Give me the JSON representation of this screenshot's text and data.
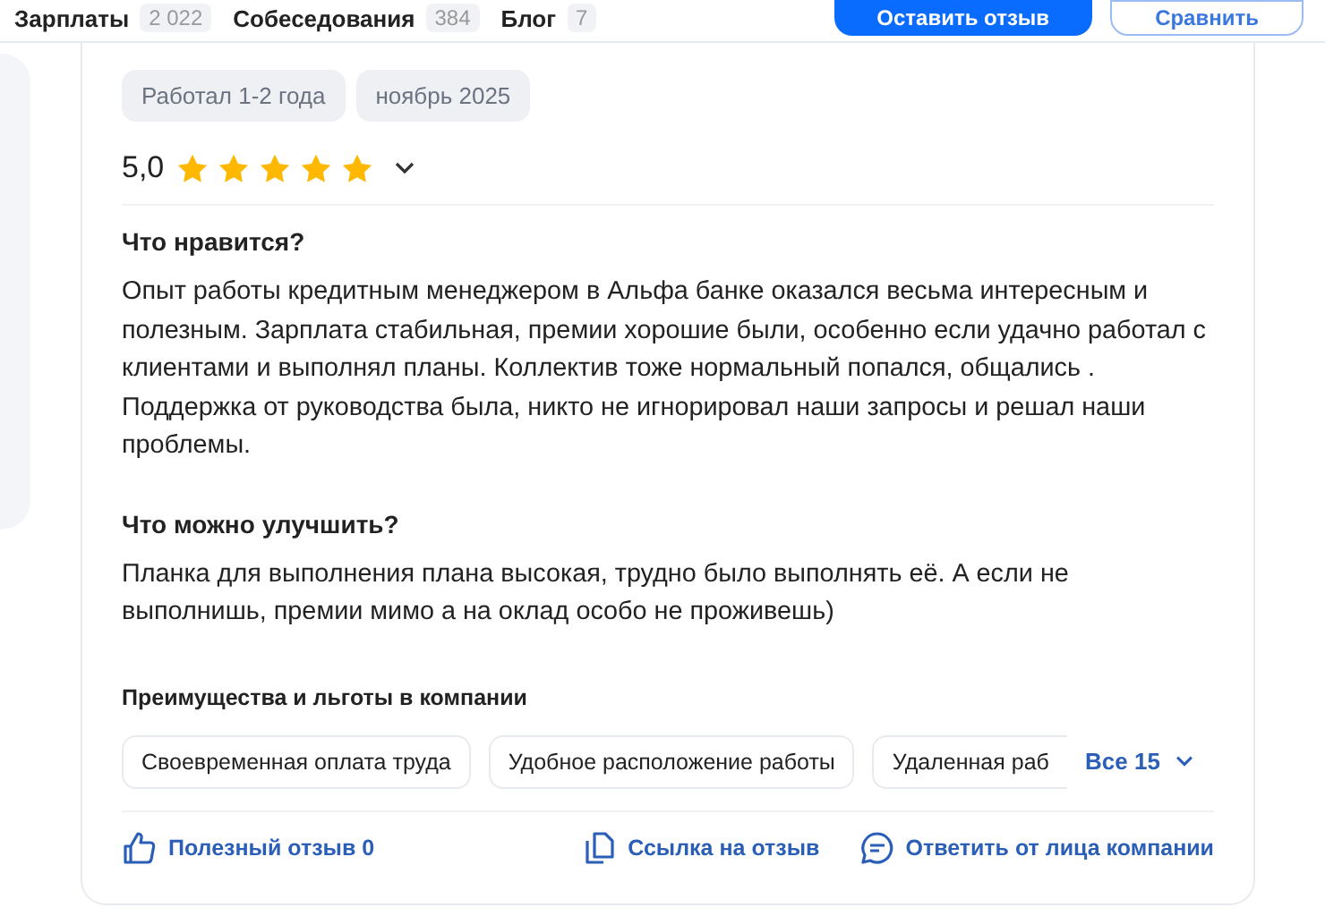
{
  "nav": {
    "items": [
      {
        "label": "Зарплаты",
        "count": "2 022"
      },
      {
        "label": "Собеседования",
        "count": "384"
      },
      {
        "label": "Блог",
        "count": "7"
      }
    ],
    "buttons": [
      {
        "label": "Оставить отзыв",
        "kind": "primary"
      },
      {
        "label": "Сравнить",
        "kind": "outline"
      }
    ]
  },
  "review": {
    "tags": [
      "Работал 1-2 года",
      "ноябрь 2025"
    ],
    "rating": "5,0",
    "stars": 5,
    "sections": [
      {
        "title": "Что нравится?",
        "text": "Опыт работы кредитным менеджером в Альфа банке оказался весьма интересным и полезным. Зарплата стабильная, премии хорошие были, особенно если удачно работал с клиентами и выполнял планы. Коллектив тоже нормальный попался, общались . Поддержка от руководства была, никто не игнорировал наши запросы и решал наши проблемы."
      },
      {
        "title": "Что можно улучшить?",
        "text": "Планка для выполнения плана высокая, трудно было выполнять её. А если не выполнишь, премии мимо а на оклад особо не проживешь)"
      }
    ],
    "benefits": {
      "title": "Преимущества и льготы в компании",
      "items": [
        "Своевременная оплата труда",
        "Удобное расположение работы",
        "Удаленная раб"
      ],
      "more": "Все 15"
    },
    "actions": [
      {
        "label": "Полезный отзыв 0",
        "kind": "like"
      },
      {
        "label": "Ссылка на отзыв",
        "kind": "link"
      },
      {
        "label": "Ответить от лица компании",
        "kind": "reply"
      }
    ]
  }
}
